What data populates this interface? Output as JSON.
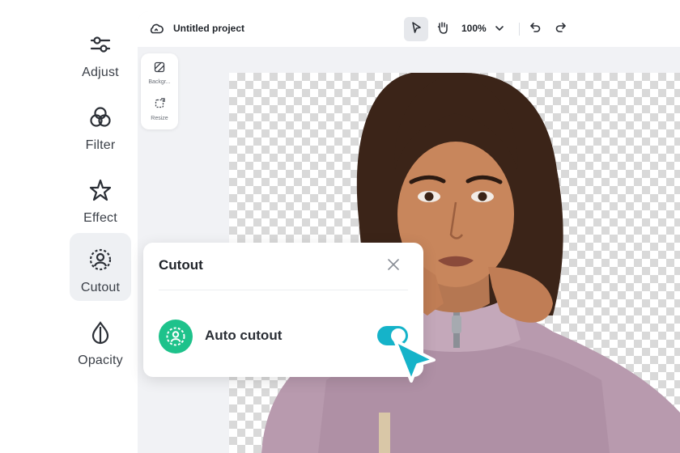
{
  "sidebar": {
    "items": [
      {
        "label": "Adjust",
        "icon": "sliders-icon"
      },
      {
        "label": "Filter",
        "icon": "circles-icon"
      },
      {
        "label": "Effect",
        "icon": "star-sparkle-icon"
      },
      {
        "label": "Cutout",
        "icon": "cutout-person-icon",
        "active": true
      },
      {
        "label": "Opacity",
        "icon": "droplet-icon"
      }
    ]
  },
  "topbar": {
    "project_title": "Untitled project",
    "zoom": "100%",
    "icons": [
      "cloud-icon",
      "select-pointer-icon",
      "hand-icon",
      "chevron-down-icon",
      "undo-icon",
      "redo-icon"
    ]
  },
  "mini_panel": {
    "items": [
      {
        "label": "Backgr...",
        "icon": "background-icon"
      },
      {
        "label": "Resize",
        "icon": "resize-icon"
      }
    ]
  },
  "cutout_popup": {
    "title": "Cutout",
    "option_label": "Auto cutout",
    "toggle_on": true
  },
  "colors": {
    "accent_teal": "#15b3c9",
    "cutout_green": "#1ec28b",
    "panel_bg": "#f1f2f5",
    "sweater": "#b89aae"
  }
}
